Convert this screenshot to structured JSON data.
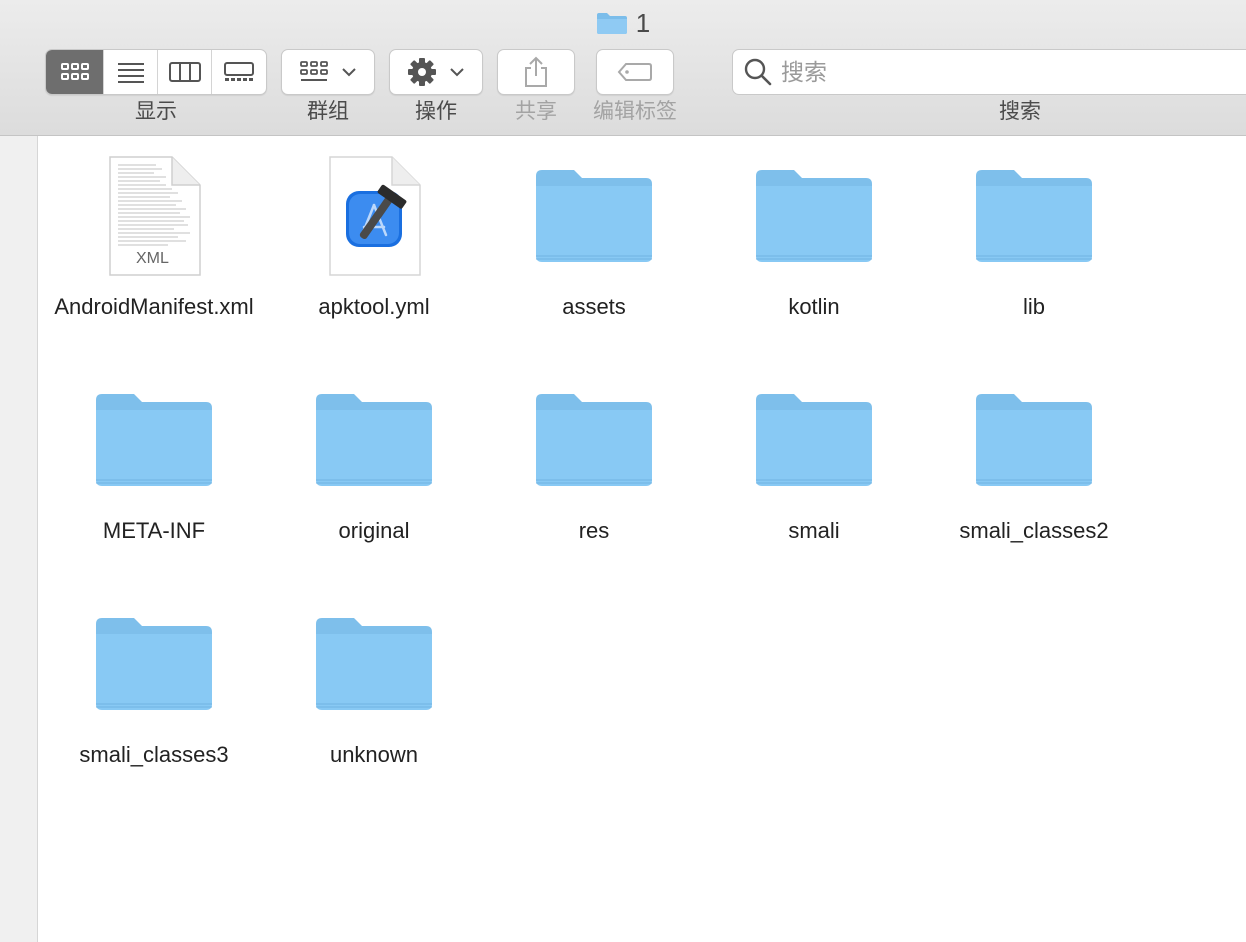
{
  "window": {
    "title": "1"
  },
  "toolbar": {
    "view_label": "显示",
    "group_label": "群组",
    "action_label": "操作",
    "share_label": "共享",
    "tags_label": "编辑标签",
    "search_label": "搜索",
    "search_placeholder": "搜索"
  },
  "colors": {
    "folder_top": "#8ec9f3",
    "folder_body": "#84c6f3",
    "active_segment": "#6e6e6e",
    "xcode_blue": "#1a6fe0"
  },
  "files": [
    {
      "name": "AndroidManifest.xml",
      "kind": "xml-document-icon",
      "badge": "XML"
    },
    {
      "name": "apktool.yml",
      "kind": "xcode-document-icon"
    },
    {
      "name": "assets",
      "kind": "folder-icon"
    },
    {
      "name": "kotlin",
      "kind": "folder-icon"
    },
    {
      "name": "lib",
      "kind": "folder-icon"
    },
    {
      "name": "META-INF",
      "kind": "folder-icon"
    },
    {
      "name": "original",
      "kind": "folder-icon"
    },
    {
      "name": "res",
      "kind": "folder-icon"
    },
    {
      "name": "smali",
      "kind": "folder-icon"
    },
    {
      "name": "smali_classes2",
      "kind": "folder-icon"
    },
    {
      "name": "smali_classes3",
      "kind": "folder-icon"
    },
    {
      "name": "unknown",
      "kind": "folder-icon"
    }
  ]
}
